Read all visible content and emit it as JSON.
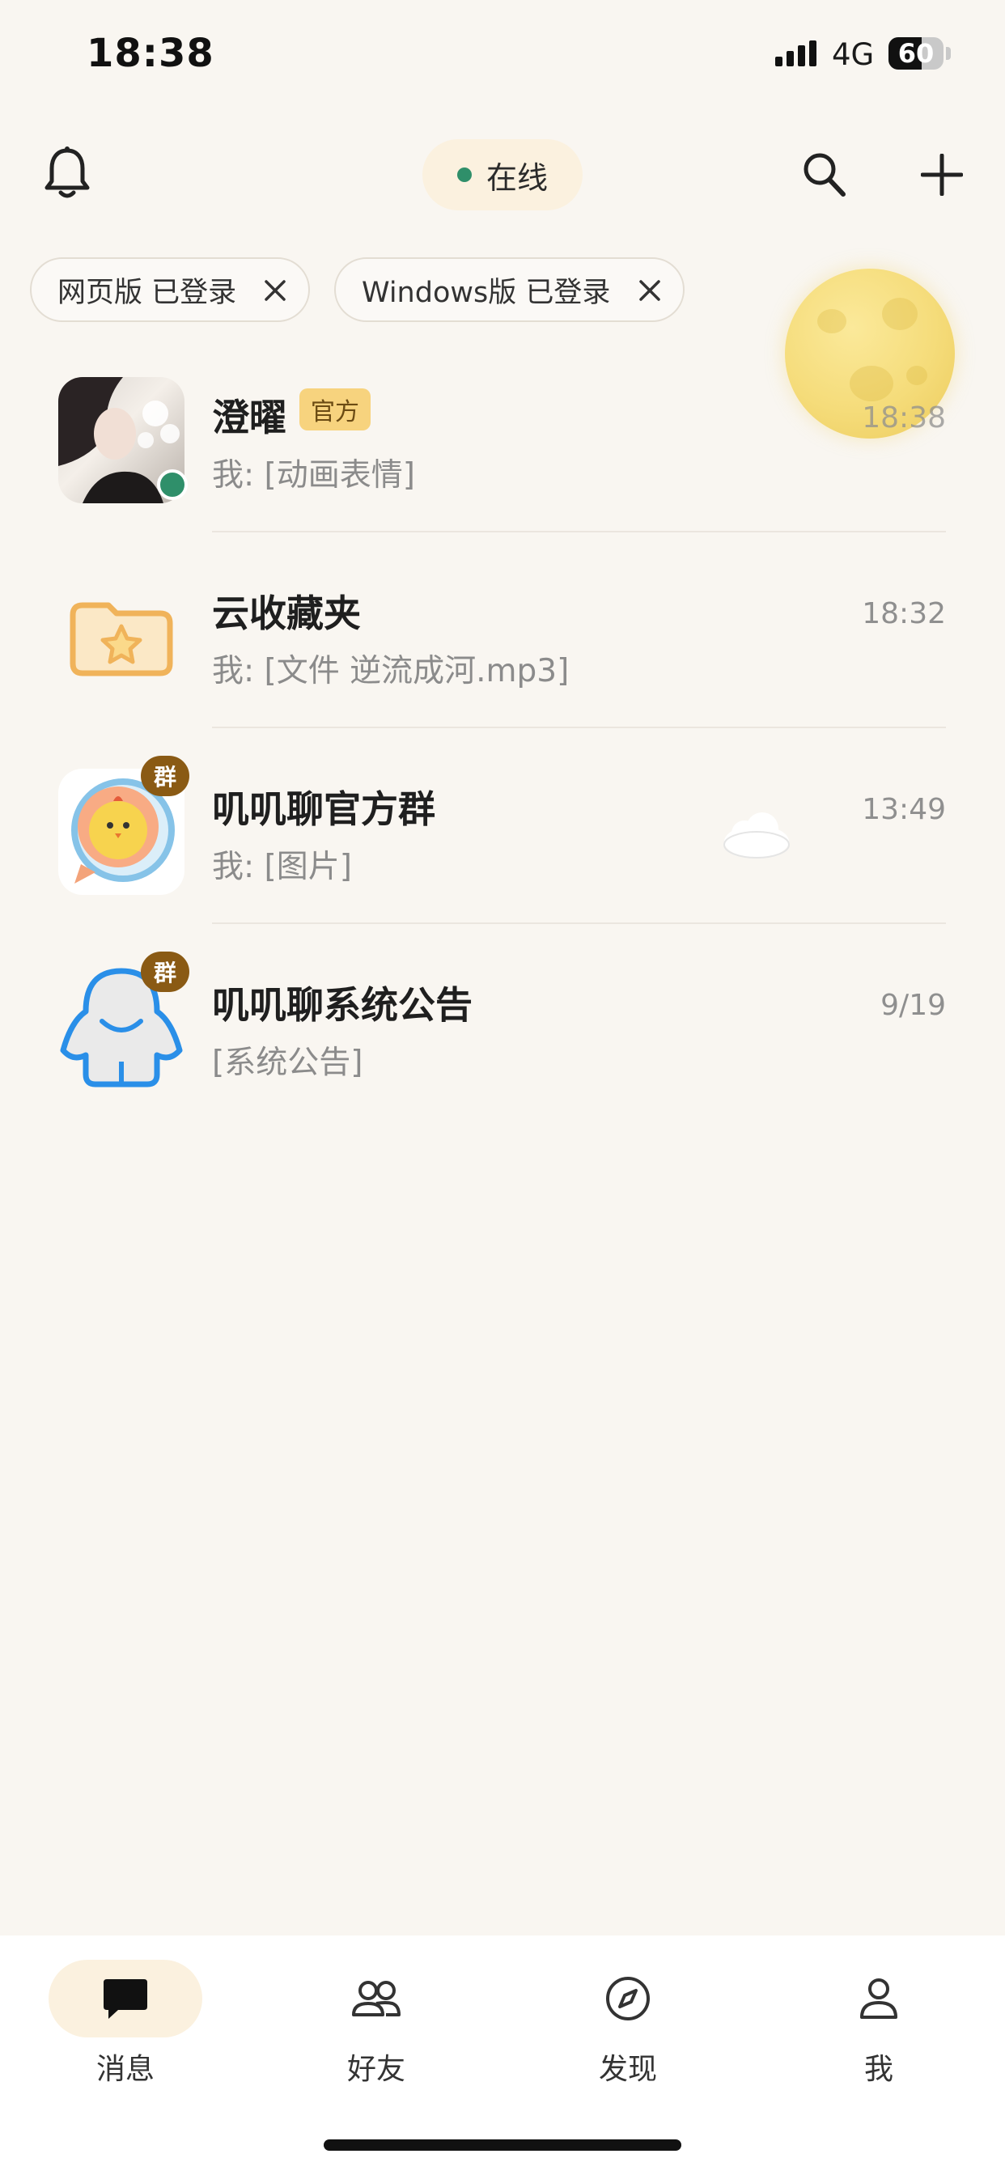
{
  "status_bar": {
    "time": "18:38",
    "network": "4G",
    "battery": "60"
  },
  "header": {
    "presence": "在线",
    "icons": [
      "bell-icon",
      "search-icon",
      "add-icon"
    ]
  },
  "login_chips": [
    {
      "label": "网页版 已登录"
    },
    {
      "label": "Windows版 已登录"
    }
  ],
  "chats": [
    {
      "name": "澄曜",
      "badge": "官方",
      "preview": "我: [动画表情]",
      "time": "18:38",
      "online": true
    },
    {
      "name": "云收藏夹",
      "preview": "我: [文件 逆流成河.mp3]",
      "time": "18:32"
    },
    {
      "name": "叽叽聊官方群",
      "badge": "群",
      "preview": "我: [图片]",
      "time": "13:49"
    },
    {
      "name": "叽叽聊系统公告",
      "badge": "群",
      "preview": "[系统公告]",
      "time": "9/19"
    }
  ],
  "tabs": [
    {
      "label": "消息",
      "icon": "message-icon",
      "active": true
    },
    {
      "label": "好友",
      "icon": "friends-icon"
    },
    {
      "label": "发现",
      "icon": "compass-icon"
    },
    {
      "label": "我",
      "icon": "profile-icon"
    }
  ],
  "colors": {
    "background": "#f9f6f1",
    "online": "#2f8f6a",
    "accent_pill": "#fbf1df",
    "official_badge": "#f7d37e",
    "group_badge": "#8a5a14"
  }
}
